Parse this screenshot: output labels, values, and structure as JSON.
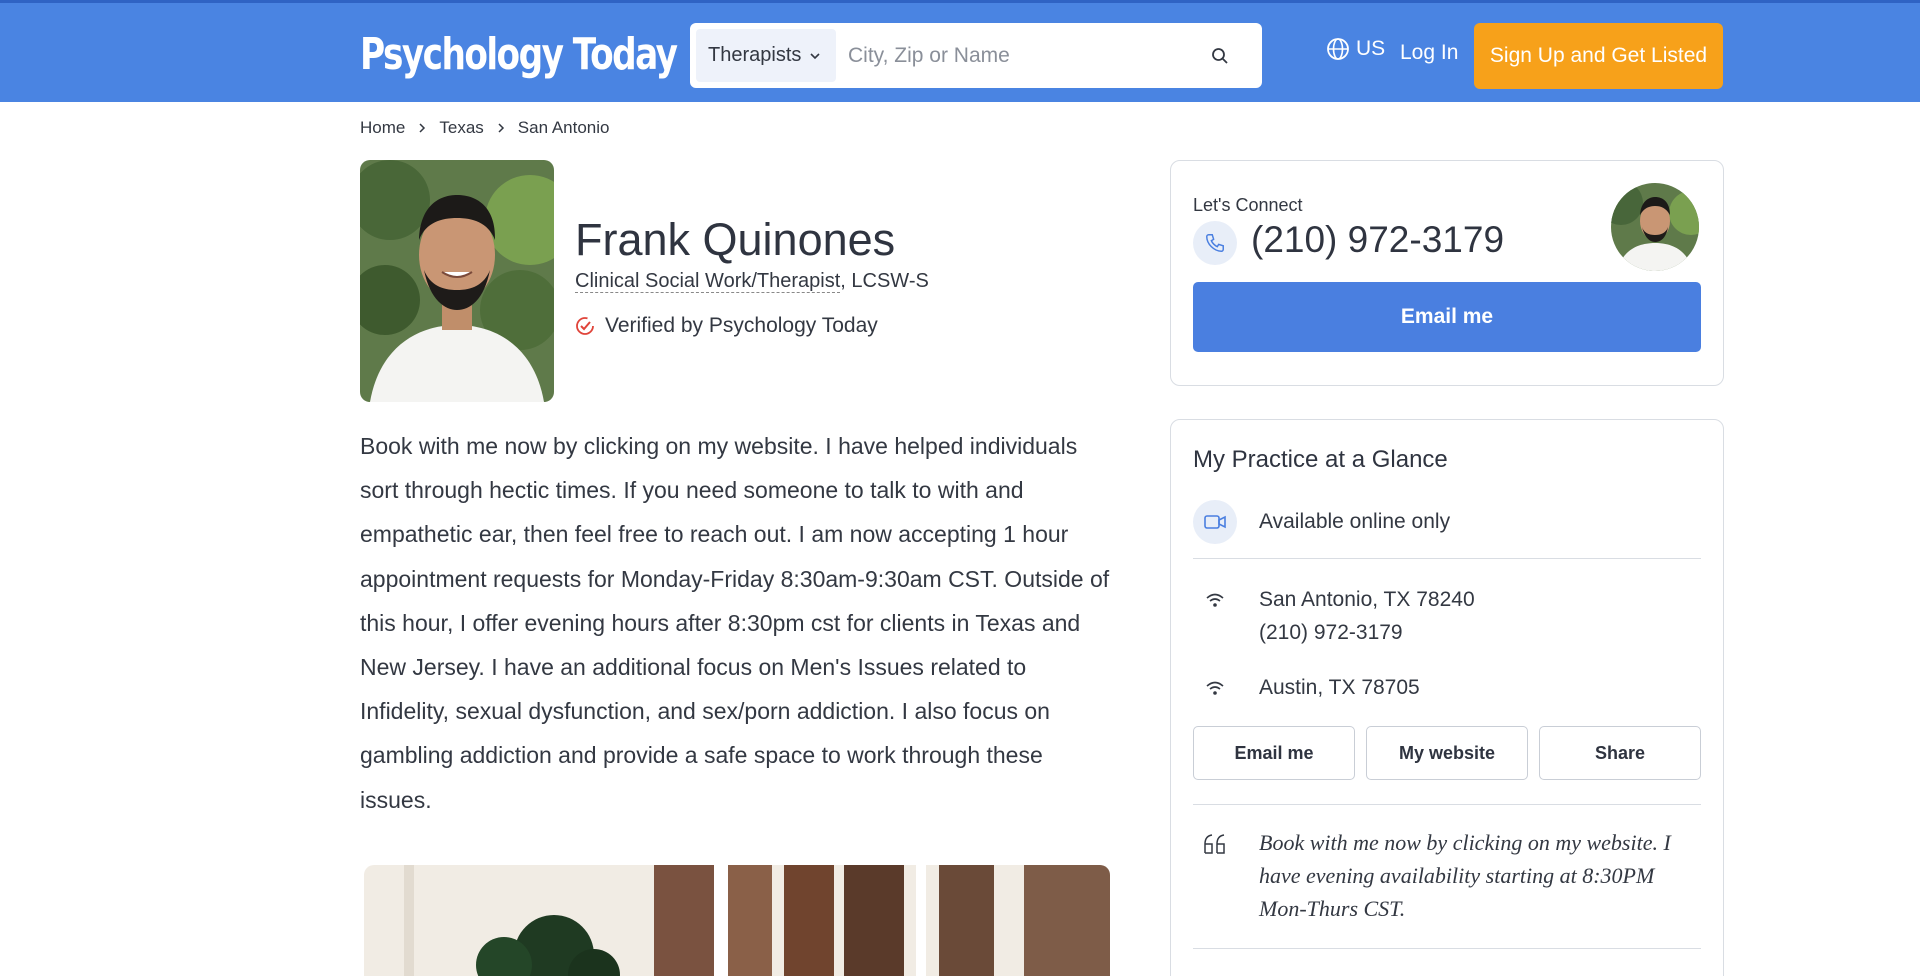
{
  "header": {
    "logo_text": "Psychology Today",
    "search_type": "Therapists",
    "search_placeholder": "City, Zip or Name",
    "region": "US",
    "login_label": "Log In",
    "signup_label": "Sign Up and Get Listed",
    "bg_color": "#4a84e2",
    "signup_color": "#f7a11a"
  },
  "breadcrumb": [
    "Home",
    "Texas",
    "San Antonio"
  ],
  "profile": {
    "name": "Frank Quinones",
    "title_part1": "Clinical Social Work/Therapist",
    "title_part2": ", LCSW-S",
    "verified": "Verified by Psychology Today",
    "bio": "Book with me now by clicking on my website. I have helped individuals sort through hectic times. If you need someone to talk to with and empathetic ear, then feel free to reach out. I am now accepting 1 hour appointment requests for Monday-Friday 8:30am-9:30am CST. Outside of this hour, I offer evening hours after 8:30pm cst for clients in Texas and New Jersey. I have an additional focus on Men's Issues related to Infidelity, sexual dysfunction, and sex/porn addiction. I also focus on gambling addiction and provide a safe space to work through these issues."
  },
  "connect": {
    "label": "Let's Connect",
    "phone": "(210) 972-3179",
    "email_button": "Email me"
  },
  "glance": {
    "title": "My Practice at a Glance",
    "online": "Available online only",
    "locations": [
      {
        "line1": "San Antonio, TX 78240",
        "line2": "(210) 972-3179"
      },
      {
        "line1": "Austin, TX 78705"
      }
    ],
    "buttons": [
      "Email me",
      "My website",
      "Share"
    ],
    "quote": "Book with me now by clicking on my website. I have evening availability starting at 8:30PM Mon-Thurs CST."
  }
}
